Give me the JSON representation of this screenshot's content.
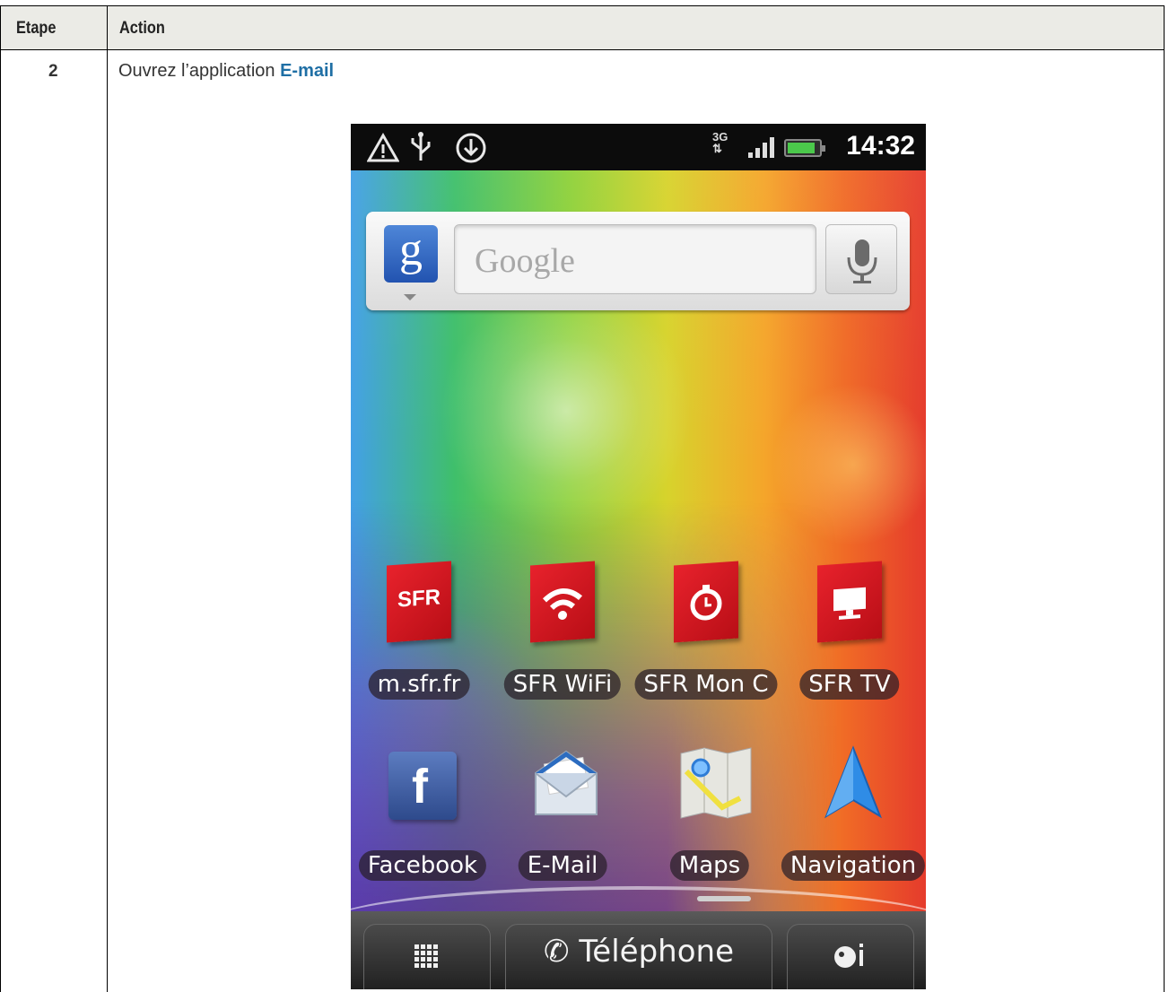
{
  "table": {
    "headers": {
      "step": "Etape",
      "action": "Action"
    },
    "rows": [
      {
        "step": "2",
        "text_prefix": "Ouvrez l’application ",
        "text_app": "E-mail"
      }
    ]
  },
  "phone": {
    "status_bar": {
      "time": "14:32",
      "network": "3G",
      "icons": [
        "warning-icon",
        "usb-icon",
        "download-icon",
        "signal-icon",
        "battery-charging-icon"
      ]
    },
    "search_widget": {
      "logo_letter": "g",
      "placeholder": "Google",
      "mic_icon": "microphone-icon"
    },
    "apps_row1": [
      {
        "label": "m.sfr.fr",
        "icon": "sfr-logo-icon",
        "icon_text": "SFR"
      },
      {
        "label": "SFR WiFi",
        "icon": "wifi-icon"
      },
      {
        "label": "SFR Mon C",
        "icon": "stopwatch-icon"
      },
      {
        "label": "SFR TV",
        "icon": "tv-icon"
      }
    ],
    "apps_row2": [
      {
        "label": "Facebook",
        "icon": "facebook-icon",
        "icon_text": "f"
      },
      {
        "label": "E-Mail",
        "icon": "email-envelope-icon"
      },
      {
        "label": "Maps",
        "icon": "maps-icon"
      },
      {
        "label": "Navigation",
        "icon": "navigation-arrow-icon"
      }
    ],
    "dock": {
      "phone_label": "Téléphone",
      "left_icon": "app-grid-icon",
      "right_icon": "personalize-icon"
    },
    "colors": {
      "sfr_red": "#d7131e",
      "link_blue": "#1f6fa5",
      "facebook_blue": "#3b5998"
    }
  }
}
